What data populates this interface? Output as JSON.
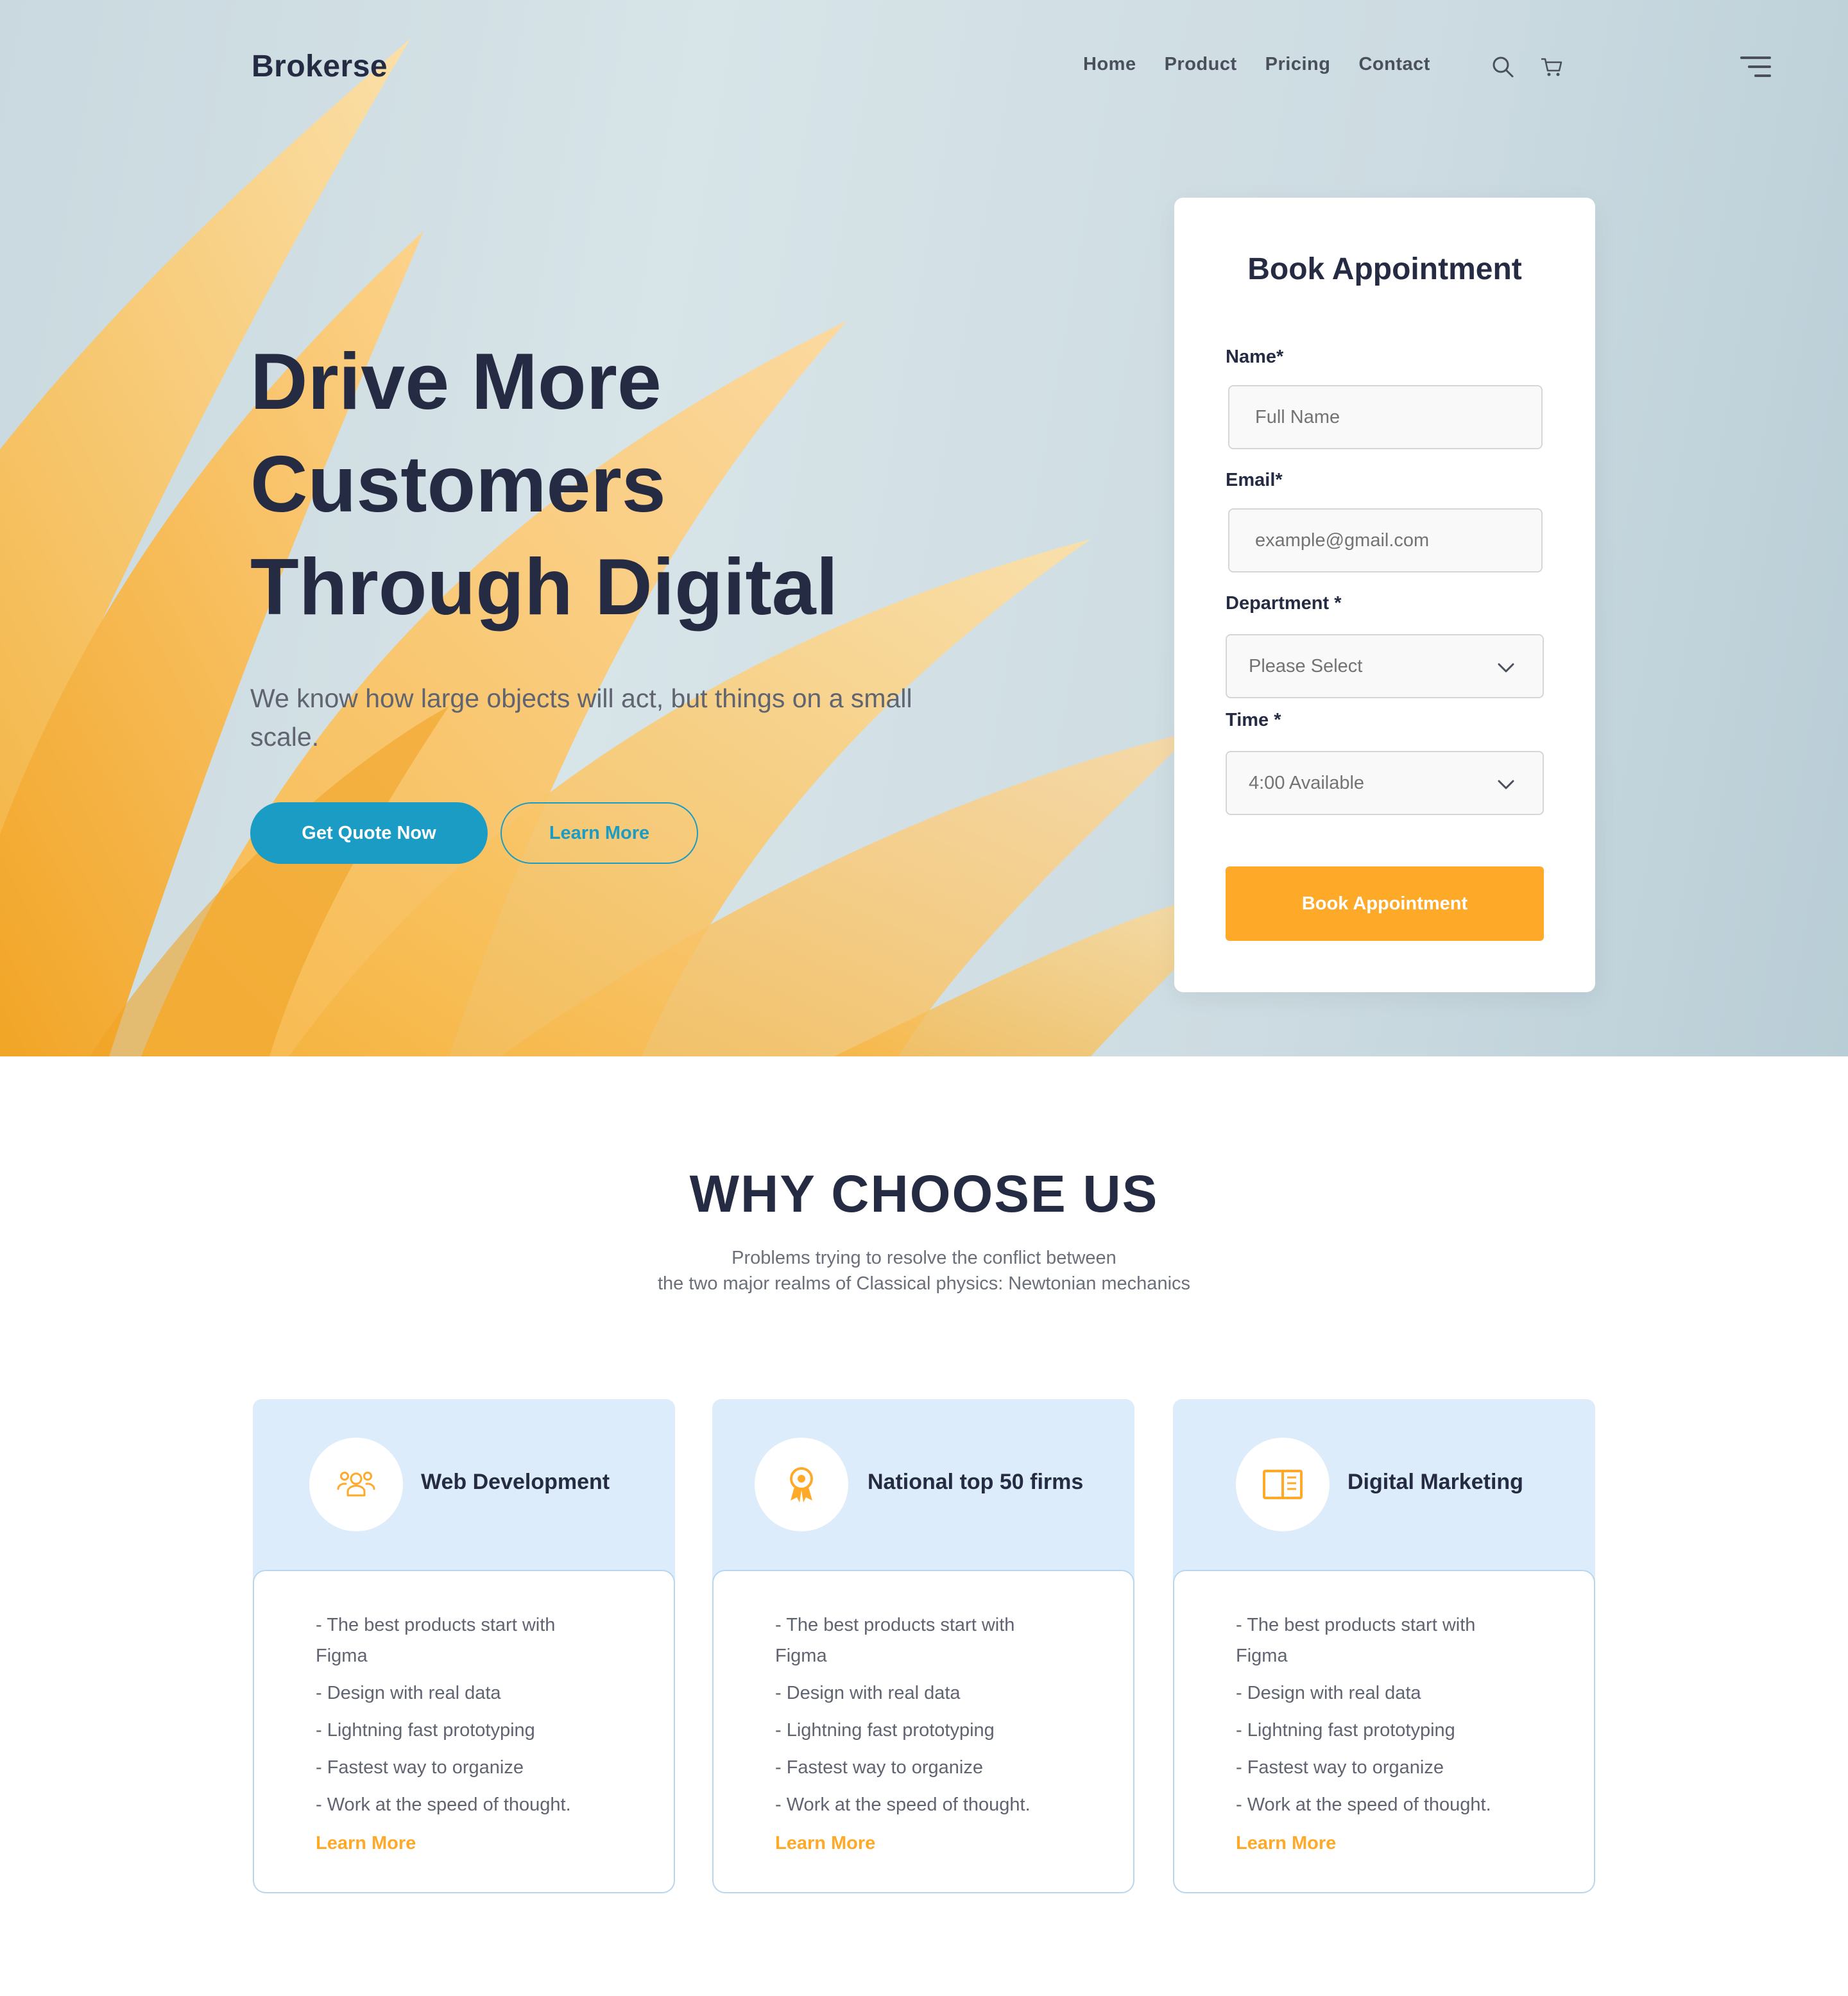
{
  "brand": {
    "logo": "Brokerse"
  },
  "nav": {
    "items": [
      "Home",
      "Product",
      "Pricing",
      "Contact"
    ]
  },
  "hero": {
    "headline": [
      "Drive More",
      "Customers",
      "Through Digital"
    ],
    "subtext": "We know how large objects will act, but things on a small scale.",
    "primary_button": "Get Quote Now",
    "secondary_button": "Learn More"
  },
  "form": {
    "title": "Book Appointment",
    "name_label": "Name*",
    "name_placeholder": "Full Name",
    "email_label": "Email*",
    "email_placeholder": "example@gmail.com",
    "department_label": "Department *",
    "department_value": "Please Select",
    "time_label": "Time *",
    "time_value": "4:00 Available",
    "submit": "Book Appointment"
  },
  "why": {
    "title": "WHY CHOOSE US",
    "subtitle_line1": "Problems trying to resolve the conflict between",
    "subtitle_line2": "the two major realms of Classical physics: Newtonian mechanics",
    "cards": [
      {
        "title": "Web Development",
        "icon": "users-icon",
        "items": [
          "-  The best products start with Figma",
          "- Design with real data",
          "- Lightning fast prototyping",
          "- Fastest way to organize",
          "- Work at the speed of thought."
        ],
        "link": "Learn More"
      },
      {
        "title": "National top 50 firms",
        "icon": "award-icon",
        "items": [
          "-  The best products start with Figma",
          "- Design with real data",
          "- Lightning fast prototyping",
          "- Fastest way to organize",
          "- Work at the speed of thought."
        ],
        "link": "Learn More"
      },
      {
        "title": "Digital Marketing",
        "icon": "book-icon",
        "items": [
          "-  The best products start with Figma",
          "- Design with real data",
          "- Lightning fast prototyping",
          "- Fastest way to organize",
          "- Work at the speed of thought."
        ],
        "link": "Learn More"
      }
    ]
  },
  "colors": {
    "primary": "#1a9cc4",
    "accent": "#FFA929",
    "dark": "#252B42",
    "card_top": "#dcecfa"
  }
}
